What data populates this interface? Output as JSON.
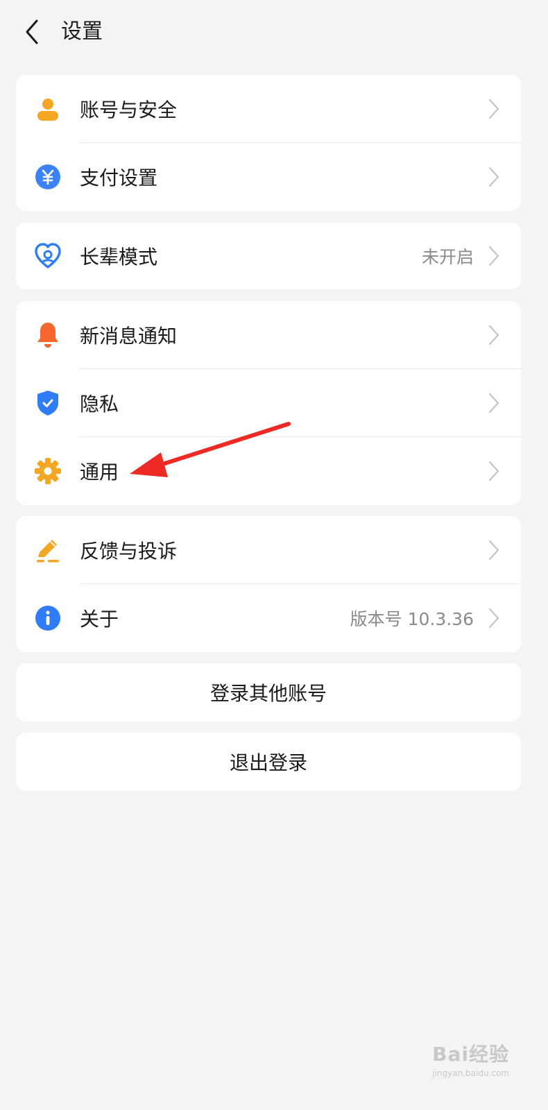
{
  "header": {
    "title": "设置",
    "back_icon": "chevron-left-icon"
  },
  "groups": [
    {
      "items": [
        {
          "label": "账号与安全",
          "icon": "user-icon",
          "color": "#f5a623"
        },
        {
          "label": "支付设置",
          "icon": "yuan-icon",
          "color": "#3b82f6"
        }
      ]
    },
    {
      "items": [
        {
          "label": "长辈模式",
          "value": "未开启",
          "icon": "heart-care-icon",
          "color": "#2f7cf6"
        }
      ]
    },
    {
      "items": [
        {
          "label": "新消息通知",
          "icon": "bell-icon",
          "color": "#f5672e"
        },
        {
          "label": "隐私",
          "icon": "shield-check-icon",
          "color": "#2f7cf6"
        },
        {
          "label": "通用",
          "icon": "gear-icon",
          "color": "#f5a623"
        }
      ]
    },
    {
      "items": [
        {
          "label": "反馈与投诉",
          "icon": "edit-pen-icon",
          "color": "#f5a623"
        },
        {
          "label": "关于",
          "value": "版本号 10.3.36",
          "icon": "info-icon",
          "color": "#2f7cf6"
        }
      ]
    }
  ],
  "buttons": {
    "switch_account": "登录其他账号",
    "logout": "退出登录"
  },
  "annotation": {
    "color": "#ee2a24"
  },
  "watermark": {
    "brand": "Bai经验",
    "url": "jingyan.baidu.com"
  }
}
